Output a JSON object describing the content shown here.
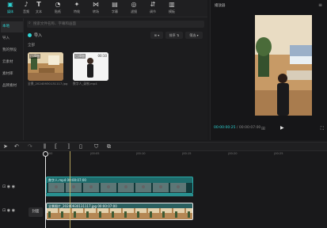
{
  "toolbar": {
    "items": [
      {
        "label": "媒体",
        "icon": "media-icon"
      },
      {
        "label": "音频",
        "icon": "audio-icon"
      },
      {
        "label": "文本",
        "icon": "text-icon"
      },
      {
        "label": "贴纸",
        "icon": "sticker-icon"
      },
      {
        "label": "特效",
        "icon": "effects-icon"
      },
      {
        "label": "转场",
        "icon": "transition-icon"
      },
      {
        "label": "字幕",
        "icon": "caption-icon"
      },
      {
        "label": "滤镜",
        "icon": "filter-icon"
      },
      {
        "label": "调节",
        "icon": "adjust-icon"
      },
      {
        "label": "模板",
        "icon": "template-icon"
      }
    ]
  },
  "leftnav": {
    "items": [
      "本地",
      "导入",
      "我的预设",
      "云素材",
      "素材库",
      "品牌素材"
    ]
  },
  "media": {
    "search_placeholder": "搜索文件名称、字幕和画面",
    "import_label": "导入",
    "sort_label": "排序",
    "filter_label": "筛选",
    "section_label": "全部",
    "items": [
      {
        "badge": "已添加",
        "filename": "全景_20240930131117.jpg",
        "duration": ""
      },
      {
        "badge": "已添加",
        "filename": "数字人_录制.mp4",
        "duration": "00:10"
      }
    ]
  },
  "player": {
    "title": "播放器",
    "current_time": "00:00:00:25",
    "total_time": "00:00:07:00"
  },
  "timeline": {
    "ruler": [
      "00:00",
      "|00:05",
      "|00:10",
      "|00:15",
      "|00:20",
      "|00:25"
    ],
    "clip1_label": "数字人.mp4  00:00:07:00",
    "clip2_label": "全景图片_20240930131117.jpg  00:00:07:00",
    "cover_label": "封面"
  },
  "colors": {
    "accent": "#2ed3d3",
    "clip_video": "#1e6b6b",
    "background": "#1a1a1c"
  }
}
